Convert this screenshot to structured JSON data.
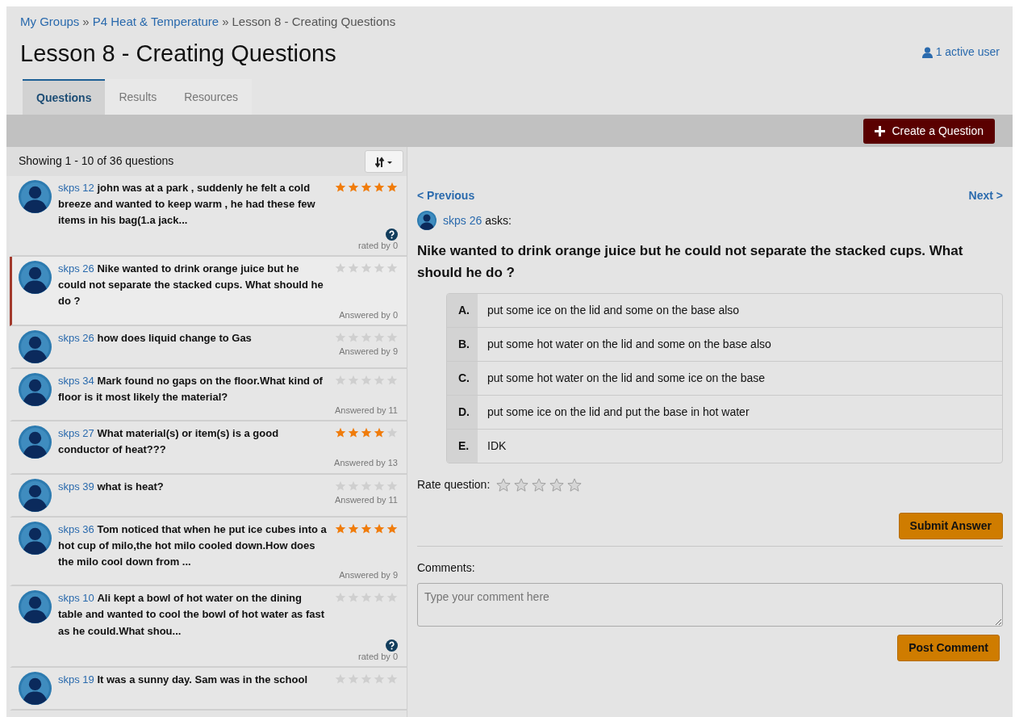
{
  "breadcrumb": [
    {
      "label": "My Groups",
      "link": true
    },
    {
      "label": "P4 Heat & Temperature",
      "link": true
    },
    {
      "label": "Lesson 8 - Creating Questions",
      "link": false
    }
  ],
  "breadcrumb_separator": "»",
  "title": "Lesson 8 - Creating Questions",
  "active_users": "1 active user",
  "tabs": [
    {
      "label": "Questions",
      "selected": true
    },
    {
      "label": "Results",
      "selected": false
    },
    {
      "label": "Resources",
      "selected": false
    }
  ],
  "create_button": "Create a Question",
  "list_header": "Showing 1 - 10 of 36 questions",
  "questions": [
    {
      "author": "skps 12",
      "text": "john was at a park , suddenly he felt a cold breeze and wanted to keep warm , he had these few items in his bag(1.a jack...",
      "stars": 5,
      "kind": "rated",
      "footer": "rated by 0",
      "selected": false
    },
    {
      "author": "skps 26",
      "text": "Nike wanted to drink orange juice but he could not separate the stacked cups. What should he do ?",
      "stars": 0,
      "kind": "answered",
      "footer": "Answered by 0",
      "selected": true
    },
    {
      "author": "skps 26",
      "text": "how does liquid change to Gas",
      "stars": 0,
      "kind": "answered",
      "footer": "Answered by 9",
      "selected": false
    },
    {
      "author": "skps 34",
      "text": "Mark found no gaps on the floor.What kind of floor is it most likely the material?",
      "stars": 0,
      "kind": "answered",
      "footer": "Answered by 11",
      "selected": false
    },
    {
      "author": "skps 27",
      "text": "What material(s) or item(s) is a good conductor of heat???",
      "stars": 4,
      "kind": "answered",
      "footer": "Answered by 13",
      "selected": false
    },
    {
      "author": "skps 39",
      "text": "what is heat?",
      "stars": 0,
      "kind": "answered",
      "footer": "Answered by 11",
      "selected": false
    },
    {
      "author": "skps 36",
      "text": "Tom noticed that when he put ice cubes into a hot cup of milo,the hot milo cooled down.How does the milo cool down from ...",
      "stars": 5,
      "kind": "answered",
      "footer": "Answered by 9",
      "selected": false
    },
    {
      "author": "skps 10",
      "text": "Ali kept a bowl of hot water on the dining table and wanted to cool the bowl of hot water as fast as he could.What shou...",
      "stars": 0,
      "kind": "rated",
      "footer": "rated by 0",
      "selected": false
    },
    {
      "author": "skps 19",
      "text": "It was a sunny day. Sam was in the school",
      "stars": 0,
      "kind": "cut",
      "selected": false
    }
  ],
  "nav": {
    "previous": "< Previous",
    "next": "Next >"
  },
  "asker": {
    "author": "skps 26",
    "suffix": "asks:"
  },
  "question": "Nike wanted to drink orange juice but he could not separate the stacked cups. What should he do ?",
  "options": [
    {
      "letter": "A.",
      "text": "put some ice on the lid and some on the base also"
    },
    {
      "letter": "B.",
      "text": "put some hot water on the lid and some on the base also"
    },
    {
      "letter": "C.",
      "text": "put some hot water on the lid and some ice on the base"
    },
    {
      "letter": "D.",
      "text": "put some ice on the lid and put the base in hot water"
    },
    {
      "letter": "E.",
      "text": "IDK"
    }
  ],
  "rate": {
    "label": "Rate question:",
    "stars": 0
  },
  "submit_button": "Submit Answer",
  "comments": {
    "label": "Comments:",
    "placeholder": "Type your comment here"
  },
  "post_button": "Post Comment"
}
